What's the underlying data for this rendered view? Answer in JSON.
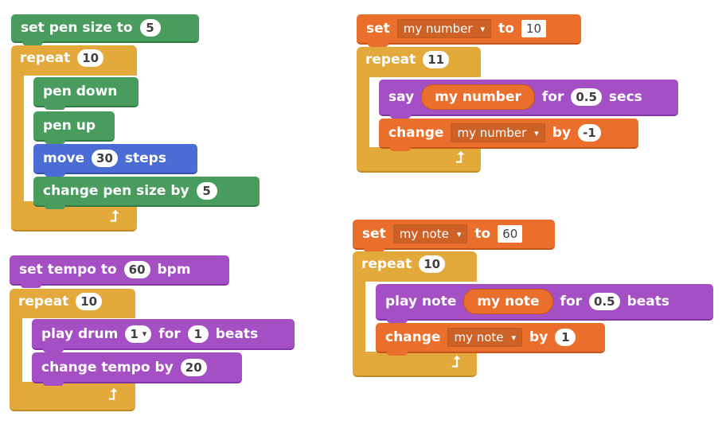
{
  "scripts": {
    "pen": {
      "set_pen_size": {
        "label": "set pen size to",
        "value": "5"
      },
      "repeat": {
        "label": "repeat",
        "count": "10"
      },
      "pen_down": {
        "label": "pen down"
      },
      "pen_up": {
        "label": "pen up"
      },
      "move": {
        "label": "move",
        "value": "30",
        "suffix": "steps"
      },
      "change_pen_size": {
        "label": "change pen size by",
        "value": "5"
      }
    },
    "music": {
      "set_tempo": {
        "label": "set tempo to",
        "value": "60",
        "suffix": "bpm"
      },
      "repeat": {
        "label": "repeat",
        "count": "10"
      },
      "play_drum": {
        "label": "play drum",
        "drum": "1",
        "mid": "for",
        "beats": "1",
        "suffix": "beats"
      },
      "change_tempo": {
        "label": "change tempo by",
        "value": "20"
      }
    },
    "number": {
      "set_var": {
        "label": "set",
        "variable": "my number",
        "mid": "to",
        "value": "10"
      },
      "repeat": {
        "label": "repeat",
        "count": "11"
      },
      "say": {
        "label": "say",
        "reporter": "my number",
        "mid": "for",
        "secs": "0.5",
        "suffix": "secs"
      },
      "change_var": {
        "label": "change",
        "variable": "my number",
        "mid": "by",
        "value": "-1"
      }
    },
    "note": {
      "set_var": {
        "label": "set",
        "variable": "my note",
        "mid": "to",
        "value": "60"
      },
      "repeat": {
        "label": "repeat",
        "count": "10"
      },
      "play_note": {
        "label": "play note",
        "reporter": "my note",
        "mid": "for",
        "beats": "0.5",
        "suffix": "beats"
      },
      "change_var": {
        "label": "change",
        "variable": "my note",
        "mid": "by",
        "value": "1"
      }
    }
  },
  "glyphs": {
    "loop_arrow": "⮥",
    "dropdown": "▾"
  },
  "colors": {
    "pen": "#4a9b5e",
    "motion": "#4a6cd4",
    "looks_sound": "#a54fc5",
    "data": "#ea6f2c",
    "control": "#e3a93b"
  }
}
